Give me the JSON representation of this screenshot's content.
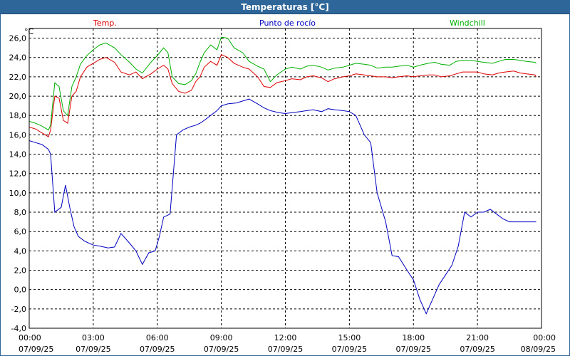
{
  "window": {
    "title": "Temperaturas [°C]"
  },
  "chart_data": {
    "type": "line",
    "title": "Temperaturas [°C]",
    "ylabel": "°C",
    "ylim": [
      -4,
      27
    ],
    "y_ticks": [
      "26,0",
      "24,0",
      "22,0",
      "20,0",
      "18,0",
      "16,0",
      "14,0",
      "12,0",
      "10,0",
      "8,0",
      "6,0",
      "4,0",
      "2,0",
      "0,0",
      "-2,0",
      "-4,0"
    ],
    "x_ticks": [
      {
        "time": "00:00",
        "date": "07/09/25"
      },
      {
        "time": "03:00",
        "date": "07/09/25"
      },
      {
        "time": "06:00",
        "date": "07/09/25"
      },
      {
        "time": "09:00",
        "date": "07/09/25"
      },
      {
        "time": "12:00",
        "date": "07/09/25"
      },
      {
        "time": "15:00",
        "date": "07/09/25"
      },
      {
        "time": "18:00",
        "date": "07/09/25"
      },
      {
        "time": "21:00",
        "date": "07/09/25"
      },
      {
        "time": "00:00",
        "date": "08/09/25"
      }
    ],
    "grid": true,
    "legend_placement": "top",
    "series": [
      {
        "name": "Temp.",
        "color": "#e00000",
        "x": [
          0,
          0.3,
          0.6,
          0.9,
          1.0,
          1.2,
          1.4,
          1.6,
          1.8,
          2.0,
          2.2,
          2.4,
          2.7,
          3.0,
          3.3,
          3.6,
          4.0,
          4.3,
          4.7,
          5.0,
          5.3,
          5.7,
          6.0,
          6.3,
          6.5,
          6.7,
          7.0,
          7.3,
          7.6,
          7.8,
          8.0,
          8.2,
          8.5,
          8.8,
          9.0,
          9.3,
          9.6,
          10.0,
          10.3,
          10.7,
          11.0,
          11.3,
          11.6,
          12.0,
          12.3,
          12.7,
          13.0,
          13.3,
          13.7,
          14.0,
          14.3,
          14.7,
          15.0,
          15.3,
          15.7,
          16.0,
          16.3,
          16.7,
          17.0,
          17.3,
          17.7,
          18.0,
          18.3,
          18.7,
          19.0,
          19.3,
          19.7,
          20.0,
          20.3,
          20.7,
          21.0,
          21.3,
          21.7,
          22.0,
          22.3,
          22.7,
          23.0,
          23.3,
          23.7,
          24.0
        ],
        "values": [
          16.8,
          16.6,
          16.2,
          15.8,
          16.5,
          20.0,
          19.8,
          17.5,
          17.2,
          20.0,
          20.5,
          22.0,
          23.0,
          23.4,
          23.8,
          24.0,
          23.5,
          22.5,
          22.2,
          22.5,
          21.8,
          22.3,
          22.8,
          23.2,
          22.8,
          21.3,
          20.5,
          20.3,
          20.6,
          21.5,
          22.0,
          23.0,
          23.6,
          23.2,
          24.3,
          24.0,
          23.4,
          23.0,
          22.8,
          22.0,
          21.0,
          20.9,
          21.4,
          21.6,
          21.8,
          21.7,
          22.0,
          22.1,
          21.9,
          21.5,
          21.8,
          22.0,
          22.1,
          22.3,
          22.2,
          22.1,
          22.0,
          22.0,
          21.9,
          22.0,
          22.1,
          22.0,
          22.1,
          22.2,
          22.2,
          22.0,
          22.1,
          22.3,
          22.5,
          22.5,
          22.5,
          22.3,
          22.2,
          22.4,
          22.5,
          22.6,
          22.4,
          22.3,
          22.2,
          22.0
        ]
      },
      {
        "name": "Punto de rocío",
        "color": "#0000c0",
        "x": [
          0,
          0.3,
          0.6,
          0.9,
          1.0,
          1.2,
          1.5,
          1.7,
          1.9,
          2.1,
          2.3,
          2.6,
          3.0,
          3.3,
          3.7,
          4.0,
          4.3,
          4.7,
          5.0,
          5.3,
          5.6,
          5.9,
          6.1,
          6.3,
          6.6,
          6.9,
          7.2,
          7.5,
          7.8,
          8.0,
          8.2,
          8.5,
          8.8,
          9.0,
          9.3,
          9.7,
          10.0,
          10.3,
          10.7,
          11.0,
          11.3,
          11.7,
          12.0,
          12.3,
          12.7,
          13.0,
          13.3,
          13.7,
          14.0,
          14.3,
          14.7,
          15.0,
          15.3,
          15.7,
          16.0,
          16.3,
          16.7,
          17.0,
          17.3,
          17.7,
          18.0,
          18.3,
          18.6,
          18.9,
          19.2,
          19.5,
          19.8,
          20.1,
          20.4,
          20.7,
          21.0,
          21.3,
          21.6,
          21.9,
          22.2,
          22.5,
          22.8,
          23.1,
          23.4,
          23.7,
          24.0
        ],
        "values": [
          15.4,
          15.2,
          15.0,
          14.5,
          14.0,
          8.0,
          8.5,
          10.8,
          8.5,
          6.5,
          5.5,
          5.0,
          4.6,
          4.5,
          4.3,
          4.4,
          5.8,
          4.8,
          4.0,
          2.6,
          3.8,
          4.0,
          5.5,
          7.5,
          7.8,
          16.0,
          16.5,
          16.8,
          17.0,
          17.2,
          17.5,
          18.0,
          18.5,
          19.0,
          19.2,
          19.3,
          19.5,
          19.7,
          19.2,
          18.8,
          18.5,
          18.3,
          18.2,
          18.3,
          18.4,
          18.5,
          18.6,
          18.4,
          18.7,
          18.6,
          18.5,
          18.4,
          18.0,
          16.0,
          15.2,
          10.0,
          7.0,
          3.5,
          3.4,
          2.0,
          1.0,
          -1.0,
          -2.5,
          -1.0,
          0.5,
          1.5,
          2.5,
          4.5,
          8.0,
          7.5,
          8.0,
          8.0,
          8.3,
          7.8,
          7.3,
          7.0,
          7.0,
          7.0,
          7.0,
          7.0,
          7.0
        ],
        "note_trim": 0
      },
      {
        "name": "Windchill",
        "color": "#00b000",
        "x": [
          0,
          0.3,
          0.6,
          0.9,
          1.0,
          1.2,
          1.4,
          1.6,
          1.8,
          2.0,
          2.2,
          2.4,
          2.7,
          3.0,
          3.3,
          3.6,
          4.0,
          4.3,
          4.7,
          5.0,
          5.3,
          5.7,
          6.0,
          6.3,
          6.5,
          6.7,
          7.0,
          7.3,
          7.6,
          7.8,
          8.0,
          8.2,
          8.5,
          8.8,
          9.0,
          9.3,
          9.6,
          10.0,
          10.3,
          10.7,
          11.0,
          11.3,
          11.6,
          12.0,
          12.3,
          12.7,
          13.0,
          13.3,
          13.7,
          14.0,
          14.3,
          14.7,
          15.0,
          15.3,
          15.7,
          16.0,
          16.3,
          16.7,
          17.0,
          17.3,
          17.7,
          18.0,
          18.3,
          18.7,
          19.0,
          19.3,
          19.7,
          20.0,
          20.3,
          20.7,
          21.0,
          21.3,
          21.7,
          22.0,
          22.3,
          22.7,
          23.0,
          23.3,
          23.7,
          24.0
        ],
        "values": [
          17.4,
          17.2,
          16.9,
          16.5,
          17.0,
          21.4,
          21.0,
          18.5,
          18.0,
          21.0,
          22.0,
          23.3,
          24.2,
          24.8,
          25.3,
          25.5,
          25.0,
          24.3,
          23.5,
          22.8,
          22.4,
          23.5,
          24.2,
          25.0,
          24.5,
          22.0,
          21.3,
          21.2,
          21.6,
          22.3,
          23.5,
          24.5,
          25.3,
          24.8,
          26.1,
          26.0,
          25.0,
          24.5,
          23.6,
          23.1,
          22.8,
          21.5,
          22.2,
          22.8,
          23.0,
          22.8,
          23.1,
          23.2,
          23.0,
          22.7,
          22.9,
          23.0,
          23.2,
          23.4,
          23.3,
          23.2,
          22.9,
          23.0,
          23.0,
          23.1,
          23.2,
          23.0,
          23.2,
          23.4,
          23.5,
          23.3,
          23.2,
          23.6,
          23.7,
          23.7,
          23.6,
          23.5,
          23.4,
          23.6,
          23.8,
          23.8,
          23.7,
          23.6,
          23.5,
          23.4
        ]
      }
    ]
  }
}
